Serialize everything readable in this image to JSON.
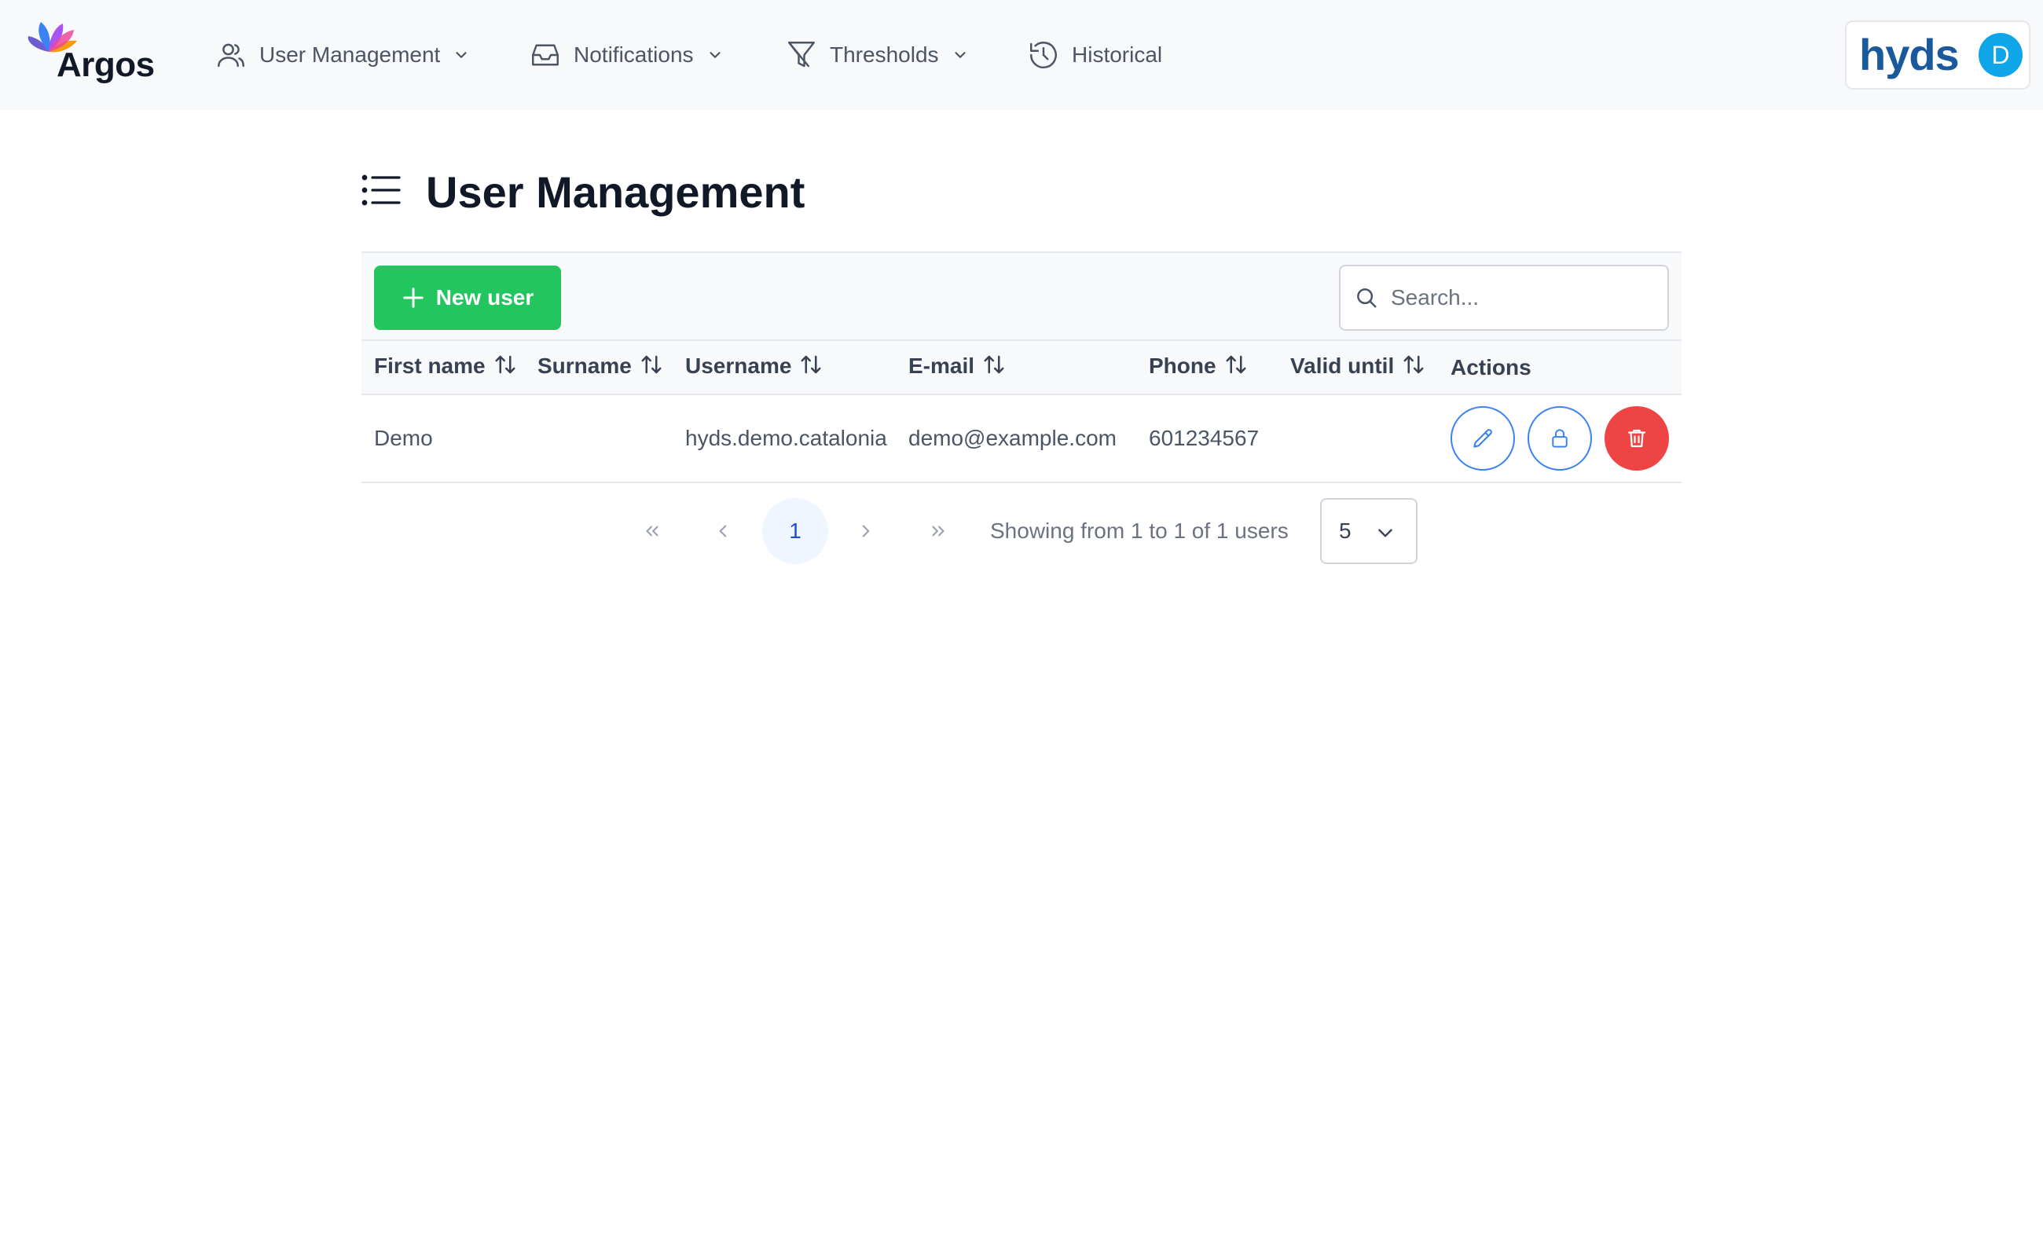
{
  "brand": {
    "name": "Argos"
  },
  "nav": [
    {
      "label": "User Management",
      "icon": "users-icon",
      "has_dropdown": true
    },
    {
      "label": "Notifications",
      "icon": "inbox-icon",
      "has_dropdown": true
    },
    {
      "label": "Thresholds",
      "icon": "filter-icon",
      "has_dropdown": true
    },
    {
      "label": "Historical",
      "icon": "history-icon",
      "has_dropdown": false
    }
  ],
  "account": {
    "logo_text": "hyds",
    "avatar_initial": "D"
  },
  "page": {
    "title": "User Management"
  },
  "toolbar": {
    "new_user_label": "New user",
    "search_placeholder": "Search..."
  },
  "table": {
    "columns": [
      "First name",
      "Surname",
      "Username",
      "E-mail",
      "Phone",
      "Valid until",
      "Actions"
    ],
    "rows": [
      {
        "first_name": "Demo",
        "surname": "",
        "username": "hyds.demo.catalonia",
        "email": "demo@example.com",
        "phone": "601234567",
        "valid_until": ""
      }
    ]
  },
  "pagination": {
    "current_page": "1",
    "info": "Showing from 1 to 1 of 1 users",
    "page_size": "5"
  },
  "colors": {
    "primary_green": "#22c55e",
    "accent_blue": "#3b82f6",
    "danger_red": "#ef4444",
    "logo_blue": "#1a5a9c"
  }
}
